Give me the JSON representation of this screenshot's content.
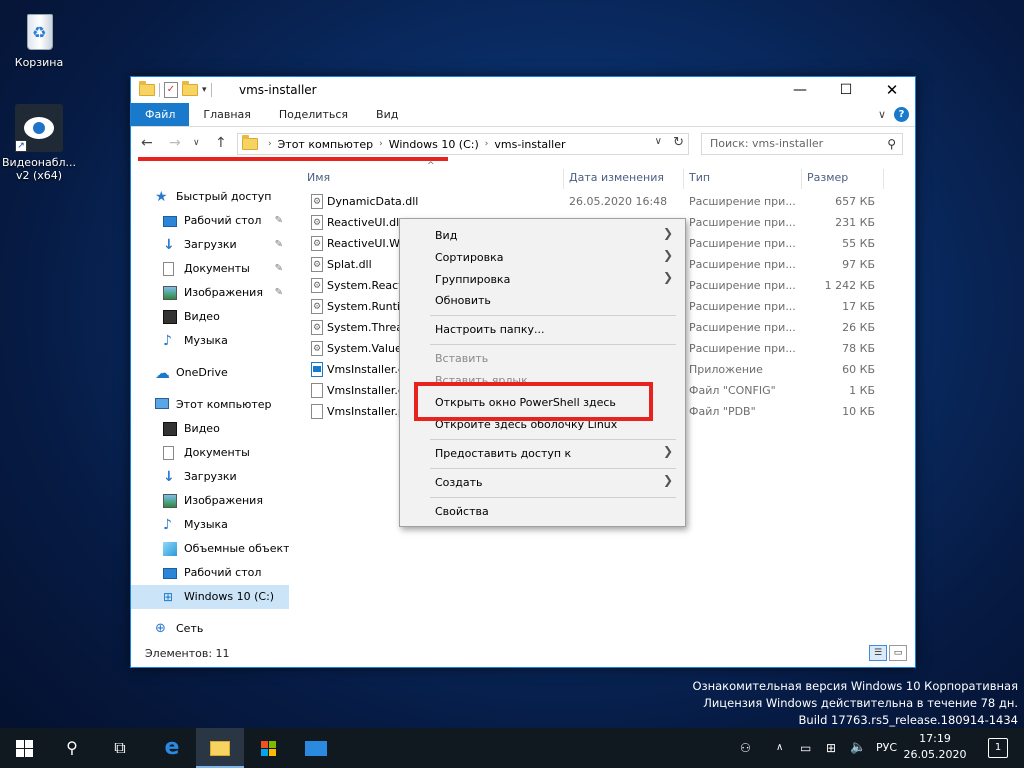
{
  "desktop": {
    "recycle_label": "Корзина",
    "vms_label": "Видеонабл... v2 (x64)"
  },
  "window": {
    "title": "vms-installer",
    "ribbon_tabs": [
      "Файл",
      "Главная",
      "Поделиться",
      "Вид"
    ],
    "breadcrumb": [
      "Этот компьютер",
      "Windows 10 (C:)",
      "vms-installer"
    ],
    "search_placeholder": "Поиск: vms-installer",
    "columns": {
      "name": "Имя",
      "date": "Дата изменения",
      "type": "Тип",
      "size": "Размер"
    },
    "status": "Элементов: 11"
  },
  "sidebar": {
    "items": [
      {
        "label": "Быстрый доступ",
        "icon": "star-icon"
      },
      {
        "label": "Рабочий стол",
        "icon": "desktop-icon",
        "pinned": true
      },
      {
        "label": "Загрузки",
        "icon": "download-icon",
        "pinned": true
      },
      {
        "label": "Документы",
        "icon": "document-icon",
        "pinned": true
      },
      {
        "label": "Изображения",
        "icon": "picture-icon",
        "pinned": true
      },
      {
        "label": "Видео",
        "icon": "video-icon"
      },
      {
        "label": "Музыка",
        "icon": "music-icon"
      },
      {
        "label": "OneDrive",
        "icon": "cloud-icon"
      },
      {
        "label": "Этот компьютер",
        "icon": "computer-icon"
      },
      {
        "label": "Видео",
        "icon": "video-icon"
      },
      {
        "label": "Документы",
        "icon": "document-icon"
      },
      {
        "label": "Загрузки",
        "icon": "download-icon"
      },
      {
        "label": "Изображения",
        "icon": "picture-icon"
      },
      {
        "label": "Музыка",
        "icon": "music-icon"
      },
      {
        "label": "Объемные объекты",
        "icon": "cube-icon"
      },
      {
        "label": "Рабочий стол",
        "icon": "desktop-icon"
      },
      {
        "label": "Windows 10 (C:)",
        "icon": "drive-icon",
        "selected": true
      },
      {
        "label": "Сеть",
        "icon": "network-icon"
      }
    ]
  },
  "files": [
    {
      "name": "DynamicData.dll",
      "date": "26.05.2020 16:48",
      "type": "Расширение при...",
      "size": "657 КБ",
      "kind": "dll"
    },
    {
      "name": "ReactiveUI.dll",
      "date": "",
      "type": "Расширение при...",
      "size": "231 КБ",
      "kind": "dll"
    },
    {
      "name": "ReactiveUI.WPF.dll",
      "date": "",
      "type": "Расширение при...",
      "size": "55 КБ",
      "kind": "dll"
    },
    {
      "name": "Splat.dll",
      "date": "",
      "type": "Расширение при...",
      "size": "97 КБ",
      "kind": "dll"
    },
    {
      "name": "System.Reactive.dll",
      "date": "",
      "type": "Расширение при...",
      "size": "1 242 КБ",
      "kind": "dll"
    },
    {
      "name": "System.Runtime...",
      "date": "",
      "type": "Расширение при...",
      "size": "17 КБ",
      "kind": "dll"
    },
    {
      "name": "System.Threading...",
      "date": "",
      "type": "Расширение при...",
      "size": "26 КБ",
      "kind": "dll"
    },
    {
      "name": "System.ValueTuple.dll",
      "date": "",
      "type": "Расширение при...",
      "size": "78 КБ",
      "kind": "dll"
    },
    {
      "name": "VmsInstaller.exe",
      "date": "",
      "type": "Приложение",
      "size": "60 КБ",
      "kind": "exe"
    },
    {
      "name": "VmsInstaller.exe.config",
      "date": "",
      "type": "Файл \"CONFIG\"",
      "size": "1 КБ",
      "kind": "file"
    },
    {
      "name": "VmsInstaller.pdb",
      "date": "",
      "type": "Файл \"PDB\"",
      "size": "10 КБ",
      "kind": "file"
    }
  ],
  "context_menu": {
    "view": "Вид",
    "sort": "Сортировка",
    "group": "Группировка",
    "refresh": "Обновить",
    "customize": "Настроить папку...",
    "paste": "Вставить",
    "paste_shortcut": "Вставить ярлык",
    "powershell": "Открыть окно PowerShell здесь",
    "linux": "Откройте здесь оболочку Linux",
    "share": "Предоставить доступ к",
    "create": "Создать",
    "properties": "Свойства"
  },
  "watermark": {
    "line1": "Ознакомительная версия Windows 10 Корпоративная",
    "line2": "Лицензия Windows действительна в течение 78 дн.",
    "line3": "Build 17763.rs5_release.180914-1434"
  },
  "taskbar": {
    "lang": "РУС",
    "time": "17:19",
    "date": "26.05.2020",
    "notifications": "1"
  }
}
